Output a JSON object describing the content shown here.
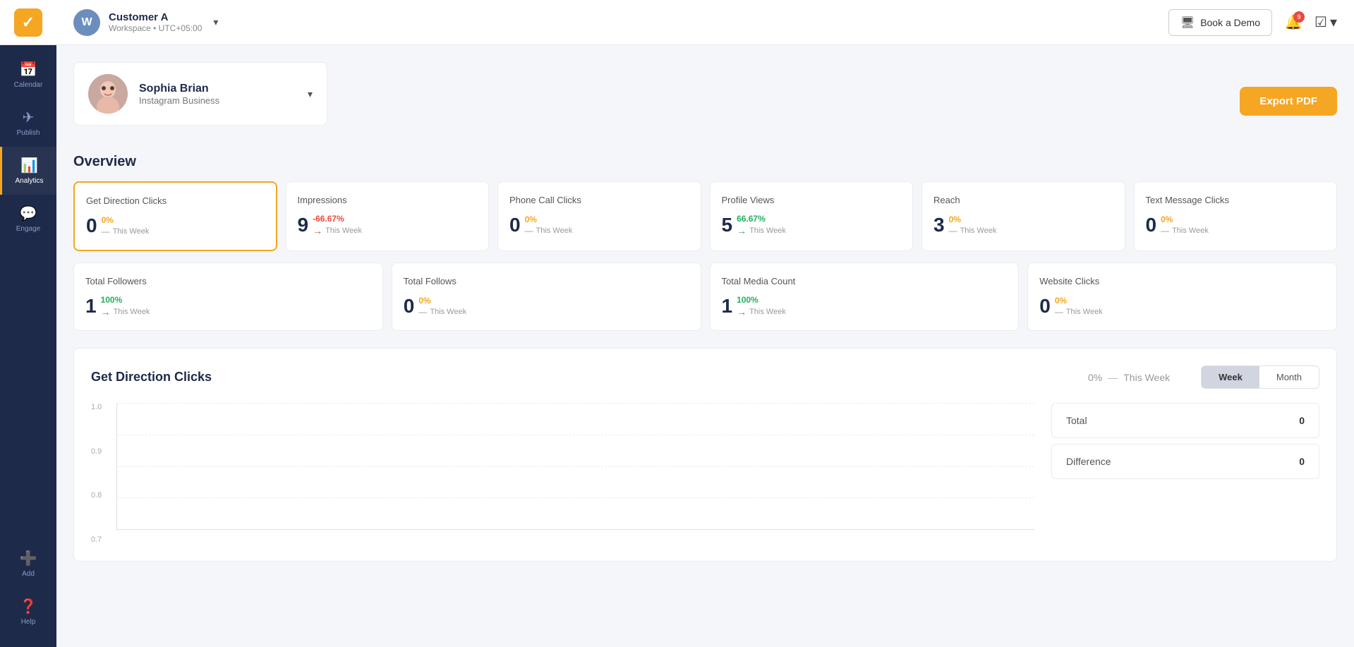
{
  "sidebar": {
    "logo_text": "✓",
    "items": [
      {
        "id": "calendar",
        "label": "Calendar",
        "icon": "📅",
        "active": false
      },
      {
        "id": "publish",
        "label": "Publish",
        "icon": "✈",
        "active": false
      },
      {
        "id": "analytics",
        "label": "Analytics",
        "icon": "📊",
        "active": true
      },
      {
        "id": "engage",
        "label": "Engage",
        "icon": "💬",
        "active": false
      }
    ],
    "bottom_items": [
      {
        "id": "add",
        "label": "Add",
        "icon": "➕"
      },
      {
        "id": "help",
        "label": "Help",
        "icon": "❓"
      }
    ]
  },
  "topbar": {
    "workspace_initial": "W",
    "workspace_name": "Customer A",
    "workspace_sub": "Workspace • UTC+05:00",
    "book_demo_label": "Book a Demo",
    "notif_count": "9"
  },
  "profile": {
    "name": "Sophia Brian",
    "platform": "Instagram Business",
    "export_label": "Export PDF"
  },
  "overview_title": "Overview",
  "stat_cards_row1": [
    {
      "title": "Get Direction Clicks",
      "value": "0",
      "pct": "0%",
      "pct_type": "neutral",
      "arrow": "dash",
      "week_label": "This Week",
      "active": true
    },
    {
      "title": "Impressions",
      "value": "9",
      "pct": "-66.67%",
      "pct_type": "negative",
      "arrow": "right-red",
      "week_label": "This Week",
      "active": false
    },
    {
      "title": "Phone Call Clicks",
      "value": "0",
      "pct": "0%",
      "pct_type": "neutral",
      "arrow": "dash",
      "week_label": "This Week",
      "active": false
    },
    {
      "title": "Profile Views",
      "value": "5",
      "pct": "66.67%",
      "pct_type": "positive",
      "arrow": "right-green",
      "week_label": "This Week",
      "active": false
    },
    {
      "title": "Reach",
      "value": "3",
      "pct": "0%",
      "pct_type": "neutral",
      "arrow": "dash",
      "week_label": "This Week",
      "active": false
    },
    {
      "title": "Text Message Clicks",
      "value": "0",
      "pct": "0%",
      "pct_type": "neutral",
      "arrow": "dash",
      "week_label": "This Week",
      "active": false
    }
  ],
  "stat_cards_row2": [
    {
      "title": "Total Followers",
      "value": "1",
      "pct": "100%",
      "pct_type": "positive",
      "arrow": "right-green",
      "week_label": "This Week",
      "active": false
    },
    {
      "title": "Total Follows",
      "value": "0",
      "pct": "0%",
      "pct_type": "neutral",
      "arrow": "dash",
      "week_label": "This Week",
      "active": false
    },
    {
      "title": "Total Media Count",
      "value": "1",
      "pct": "100%",
      "pct_type": "positive",
      "arrow": "right-green",
      "week_label": "This Week",
      "active": false
    },
    {
      "title": "Website Clicks",
      "value": "0",
      "pct": "0%",
      "pct_type": "neutral",
      "arrow": "dash",
      "week_label": "This Week",
      "active": false
    }
  ],
  "chart": {
    "title": "Get Direction Clicks",
    "pct_label": "0%",
    "dash": "—",
    "week_label": "This Week",
    "toggle_week": "Week",
    "toggle_month": "Month",
    "y_labels": [
      "1.0",
      "0.9",
      "0.8",
      "0.7"
    ],
    "panel_rows": [
      {
        "label": "Total",
        "value": "0"
      },
      {
        "label": "Difference",
        "value": "0"
      }
    ]
  }
}
